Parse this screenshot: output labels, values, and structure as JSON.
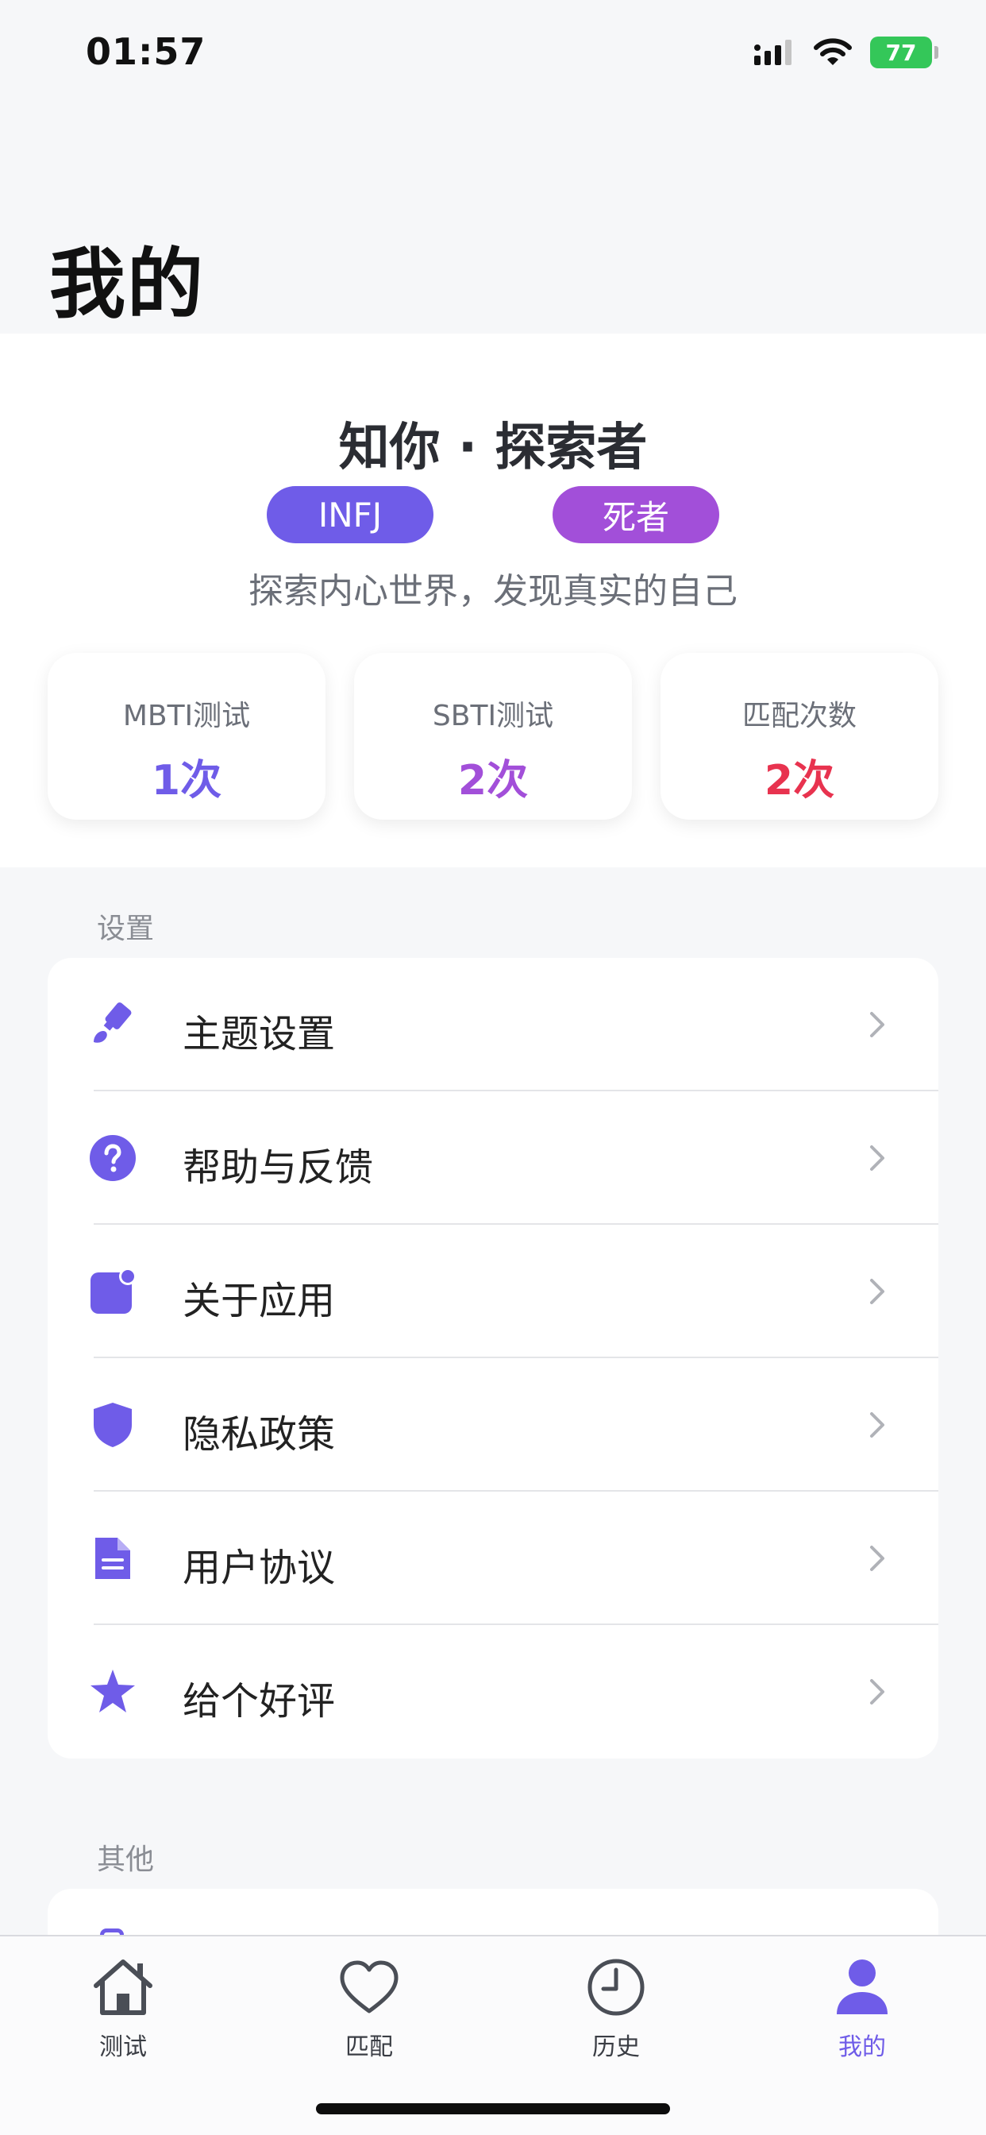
{
  "status_bar": {
    "time": "01:57",
    "battery": "77"
  },
  "page": {
    "title": "我的"
  },
  "profile": {
    "name": "知你 · 探索者",
    "mbti_chip": "INFJ",
    "sbti_chip": "死者",
    "motto": "探索内心世界，发现真实的自己",
    "stats": [
      {
        "label": "MBTI测试",
        "value": "1次",
        "color": "#6f5ce8"
      },
      {
        "label": "SBTI测试",
        "value": "2次",
        "color": "#a24fd9"
      },
      {
        "label": "匹配次数",
        "value": "2次",
        "color": "#e8334f"
      }
    ]
  },
  "settings": {
    "section_label": "设置",
    "items": [
      {
        "label": "主题设置",
        "icon": "paint-brush-icon"
      },
      {
        "label": "帮助与反馈",
        "icon": "question-circle-icon"
      },
      {
        "label": "关于应用",
        "icon": "app-badge-icon"
      },
      {
        "label": "隐私政策",
        "icon": "shield-icon"
      },
      {
        "label": "用户协议",
        "icon": "document-icon"
      },
      {
        "label": "给个好评",
        "icon": "star-icon"
      }
    ]
  },
  "other": {
    "section_label": "其他"
  },
  "tabbar": {
    "tabs": [
      {
        "label": "测试",
        "icon": "home-icon"
      },
      {
        "label": "匹配",
        "icon": "heart-icon"
      },
      {
        "label": "历史",
        "icon": "clock-icon"
      },
      {
        "label": "我的",
        "icon": "person-icon",
        "active": true
      }
    ]
  },
  "colors": {
    "accent": "#6f5ce8",
    "sbti": "#a24fd9",
    "match": "#e8334f"
  }
}
